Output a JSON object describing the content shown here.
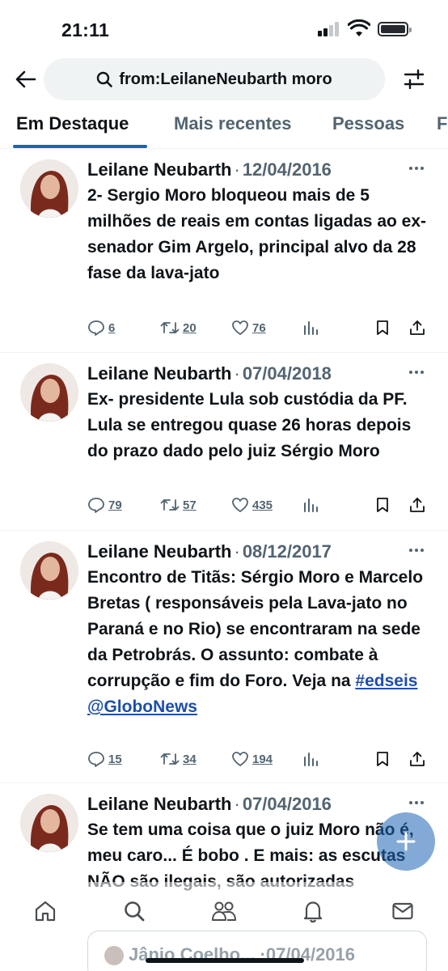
{
  "status_bar": {
    "time": "21:11"
  },
  "search": {
    "query": "from:LeilaneNeubarth moro"
  },
  "tabs": [
    {
      "label": "Em Destaque",
      "active": true
    },
    {
      "label": "Mais recentes",
      "active": false
    },
    {
      "label": "Pessoas",
      "active": false
    },
    {
      "label": "F",
      "active": false
    }
  ],
  "tweets": [
    {
      "author": "Leilane Neubarth",
      "separator": "·",
      "date": "12/04/2016",
      "text": "2- Sergio Moro bloqueou mais de 5 milhões de reais em contas ligadas ao ex-senador Gim Argelo, principal  alvo da 28 fase da lava-jato",
      "replies": "6",
      "retweets": "20",
      "likes": "76"
    },
    {
      "author": "Leilane Neubarth",
      "separator": "·",
      "date": "07/04/2018",
      "text": "Ex- presidente Lula  sob custódia da PF. Lula se entregou quase 26 horas depois do prazo dado pelo juiz Sérgio Moro",
      "replies": "79",
      "retweets": "57",
      "likes": "435"
    },
    {
      "author": "Leilane Neubarth",
      "separator": "·",
      "date": "08/12/2017",
      "text": "Encontro de Titãs: Sérgio Moro e Marcelo Bretas ( responsáveis pela Lava-jato no Paraná e no Rio) se encontraram na sede da Petrobrás. O assunto: combate à corrupção e fim do Foro. Veja na ",
      "hashtag": "#edseis",
      "mention": "@GloboNews",
      "replies": "15",
      "retweets": "34",
      "likes": "194"
    },
    {
      "author": "Leilane Neubarth",
      "separator": "·",
      "date": "07/04/2016",
      "text": "Se tem uma coisa que o juiz Moro não é, meu caro... É bobo . E mais: as escutas NÃO são ilegais, são autorizadas"
    }
  ],
  "quoted_tweet": {
    "text": "Jânio Coelho... ·07/04/2016"
  },
  "colors": {
    "accent": "#1764b8",
    "muted": "#536471",
    "text": "#0f1419",
    "search_bg": "#eff3f4"
  },
  "icons": {
    "back": "arrow-left-icon",
    "search": "search-icon",
    "filter": "sliders-icon",
    "reply": "reply-icon",
    "retweet": "retweet-icon",
    "like": "heart-icon",
    "views": "views-icon",
    "bookmark": "bookmark-icon",
    "share": "share-icon",
    "compose": "plus-icon",
    "nav": [
      "home-icon",
      "search-icon",
      "communities-icon",
      "notifications-icon",
      "messages-icon"
    ]
  }
}
